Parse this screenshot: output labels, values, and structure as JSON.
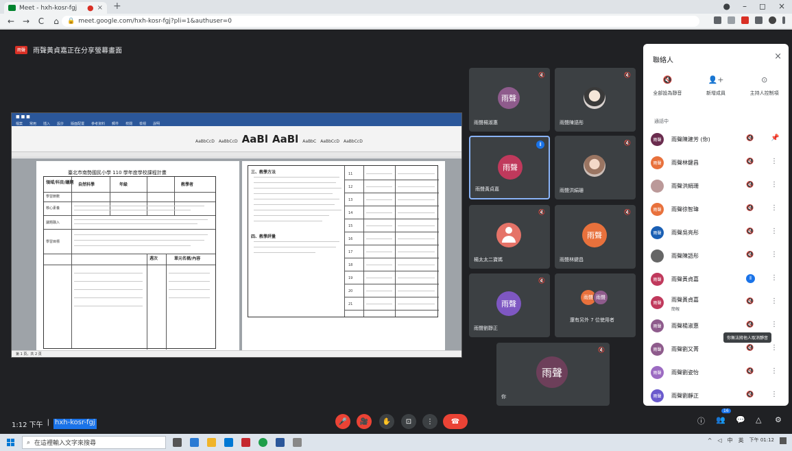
{
  "browser": {
    "tab_title": "Meet - hxh-kosr-fgj",
    "tab_dot": "●",
    "tab_close": "×",
    "new_tab": "+",
    "url": "meet.google.com/hxh-kosr-fgj?pli=1&authuser=0",
    "nav": [
      "←",
      "→",
      "C",
      "⌂"
    ],
    "window_controls": [
      "●",
      "–",
      "◻",
      "×"
    ]
  },
  "meet": {
    "presenting_badge": "雨聲",
    "presenting_text": "雨聲黃貞嘉正在分享螢幕畫面",
    "time": "1:12 下午",
    "separator": "|",
    "meeting_code": "hxh-kosr-fgj"
  },
  "shared_doc": {
    "title": "臺北市南勢國民小學 110 學年度學校課程計畫",
    "style_samples": [
      "AaBbCcD",
      "AaBbCcD",
      "AaBl",
      "AaBl",
      "AaBbC",
      "AaBbCcD",
      "AaBbCcD"
    ],
    "menu_items": [
      "檔案",
      "常用",
      "插入",
      "設計",
      "版面配置",
      "參考資料",
      "郵件",
      "校閱",
      "檢視",
      "說明"
    ],
    "left_table": {
      "headers": [
        "領域/科目/議題",
        "自然科學",
        "年級",
        "教學者"
      ],
      "row_labels": [
        "學習節數",
        "核心素養",
        "議題融入",
        "學習目標"
      ],
      "week_header": [
        "週次",
        "單元名稱/內容"
      ]
    },
    "right_table": {
      "week_numbers": [
        "11",
        "12",
        "13",
        "14",
        "15",
        "16",
        "17",
        "18",
        "19",
        "20",
        "21"
      ],
      "section_labels": [
        "三、教學方法",
        "四、教學評量"
      ]
    },
    "status_bar": "第 1 頁，共 2 頁"
  },
  "tiles": [
    {
      "name": "雨聲楊淑惠",
      "avatar_text": "雨聲",
      "avatar_color": "#8e5b8c",
      "muted": true,
      "kind": "initials"
    },
    {
      "name": "雨聲陳語彤",
      "avatar_text": "",
      "avatar_color": "",
      "muted": true,
      "kind": "photo"
    },
    {
      "name": "雨聲黃貞嘉",
      "avatar_text": "雨聲",
      "avatar_color": "#c0395c",
      "muted": false,
      "kind": "initials",
      "speaking": true
    },
    {
      "name": "雨聲洪絹珊",
      "avatar_text": "",
      "avatar_color": "",
      "muted": true,
      "kind": "photo2"
    },
    {
      "name": "楊太太二寶媽",
      "avatar_text": "",
      "avatar_color": "#e57368",
      "muted": true,
      "kind": "person"
    },
    {
      "name": "雨聲林鍵昌",
      "avatar_text": "雨聲",
      "avatar_color": "#e8713c",
      "muted": true,
      "kind": "initials"
    },
    {
      "name": "雨聲劉靜正",
      "avatar_text": "雨聲",
      "avatar_color": "#7e57c2",
      "muted": true,
      "kind": "initials"
    },
    {
      "name": "還有另外 7 位使用者",
      "avatar_text": "雨聲",
      "avatar_color": "#e8713c",
      "muted": false,
      "kind": "group"
    },
    {
      "name": "你",
      "avatar_text": "雨聲",
      "avatar_color": "#6d3f5a",
      "muted": true,
      "kind": "initials"
    }
  ],
  "controls": {
    "mic": "🎤",
    "camera": "🎥",
    "raise_hand": "✋",
    "present": "⊡",
    "more": "⋮",
    "end_call": "☎"
  },
  "right_icons": [
    "ⓘ",
    "👥",
    "💬",
    "△",
    "⚙"
  ],
  "participant_badge": "16",
  "people_panel": {
    "title": "聯絡人",
    "close": "×",
    "actions": [
      {
        "icon": "🔇",
        "label": "全部設為靜音"
      },
      {
        "icon": "👤+",
        "label": "新增成員"
      },
      {
        "icon": "⊙",
        "label": "主持人控制項"
      }
    ],
    "section": "通話中",
    "participants": [
      {
        "name": "雨聲陳建芳 (你)",
        "sub": "",
        "avatar": "雨聲",
        "color": "#6a2c4e",
        "mic": "muted",
        "extra": "📌"
      },
      {
        "name": "雨聲林鍵昌",
        "sub": "",
        "avatar": "雨聲",
        "color": "#e8713c",
        "mic": "muted",
        "extra": "⋮"
      },
      {
        "name": "雨聲洪絹珊",
        "sub": "",
        "avatar": "",
        "color": "#b99",
        "mic": "muted",
        "extra": "⋮"
      },
      {
        "name": "雨聲徐智瑋",
        "sub": "",
        "avatar": "雨聲",
        "color": "#e8713c",
        "mic": "muted",
        "extra": "⋮"
      },
      {
        "name": "雨聲吳亮彤",
        "sub": "",
        "avatar": "雨聲",
        "color": "#1a5fb4",
        "mic": "muted",
        "extra": "⋮"
      },
      {
        "name": "雨聲陳語彤",
        "sub": "",
        "avatar": "",
        "color": "#666",
        "mic": "muted",
        "extra": "⋮"
      },
      {
        "name": "雨聲黃貞嘉",
        "sub": "",
        "avatar": "雨聲",
        "color": "#c0395c",
        "mic": "speaking",
        "extra": "⋮"
      },
      {
        "name": "雨聲黃貞嘉",
        "sub": "簡報",
        "avatar": "雨聲",
        "color": "#c0395c",
        "mic": "muted",
        "extra": "⋮"
      },
      {
        "name": "雨聲楊淑惠",
        "sub": "",
        "avatar": "雨聲",
        "color": "#8e5b8c",
        "mic": "muted",
        "extra": "⋮"
      },
      {
        "name": "雨聲劉又菁",
        "sub": "",
        "avatar": "雨聲",
        "color": "#8e5b8c",
        "mic": "muted",
        "extra": "⋮"
      },
      {
        "name": "雨聲劉姿怡",
        "sub": "",
        "avatar": "雨聲",
        "color": "#9c6bc2",
        "mic": "muted",
        "extra": "⋮"
      },
      {
        "name": "雨聲劉靜正",
        "sub": "",
        "avatar": "雨聲",
        "color": "#6a5acd",
        "mic": "muted",
        "extra": "⋮"
      }
    ],
    "tooltip": "你無法將他人取消靜音"
  },
  "taskbar": {
    "search_placeholder": "在這裡輸入文字來搜尋",
    "time": "下午 01:12",
    "tray_icons": [
      "^",
      "◁",
      "中",
      "英"
    ]
  }
}
